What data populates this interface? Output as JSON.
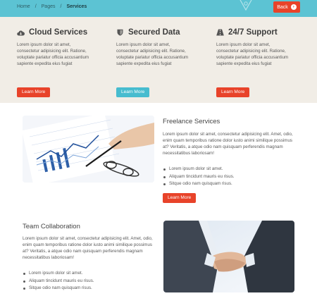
{
  "breadcrumb": {
    "home": "Home",
    "pages": "Pages",
    "current": "Services",
    "separator": "/"
  },
  "back_button": {
    "label": "Back"
  },
  "features": [
    {
      "title": "Cloud Services",
      "icon": "cloud-icon",
      "text": "Lorem ipsum dolor sit amet, consectetur adipisicing elit. Ratione, voluptate pariatur officia accusantium sapiente expedita eius fugiat",
      "button": "Learn More",
      "button_color": "#e8432a"
    },
    {
      "title": "Secured Data",
      "icon": "shield-icon",
      "text": "Lorem ipsum dolor sit amet, consectetur adipisicing elit. Ratione, voluptate pariatur officia accusantium sapiente expedita eius fugiat",
      "button": "Learn More",
      "button_color": "#47bccf"
    },
    {
      "title": "24/7 Support",
      "icon": "road-icon",
      "text": "Lorem ipsum dolor sit amet, consectetur adipisicing elit. Ratione, voluptate pariatur officia accusantium sapiente expedita eius fugiat",
      "button": "Learn More",
      "button_color": "#e8432a"
    }
  ],
  "freelance": {
    "title": "Freelance Services",
    "text": "Lorem ipsum dolor sit amet, consectetur adipisicing elit. Amet, odio, enim quam temporibus ratione dolor iusto animi similique possimus at? Veritatis, a atque odio nam quisquam perferendis magnam necessitatibus laboriosam!",
    "list": [
      "Lorem ipsum dolor sit amet.",
      "Aliquam tincidunt mauris eu risus.",
      "Sitque odio nam quisquam risus."
    ],
    "button": "Learn More",
    "image": "chart-and-pen-photo"
  },
  "team": {
    "title": "Team Collaboration",
    "text": "Lorem ipsum dolor sit amet, consectetur adipisicing elit. Amet, odio, enim quam temporibus ratione dolor iusto animi similique possimus at? Veritatis, a atque odio nam quisquam perferendis magnam necessitatibus laboriosam!",
    "list": [
      "Lorem ipsum dolor sit amet.",
      "Aliquam tincidunt mauris eu risus.",
      "Sitque odio nam quisquam risus."
    ],
    "image": "handshake-photo"
  },
  "colors": {
    "accent_red": "#e8432a",
    "accent_blue": "#5cc3d3",
    "band_bg": "#f1ede6"
  }
}
